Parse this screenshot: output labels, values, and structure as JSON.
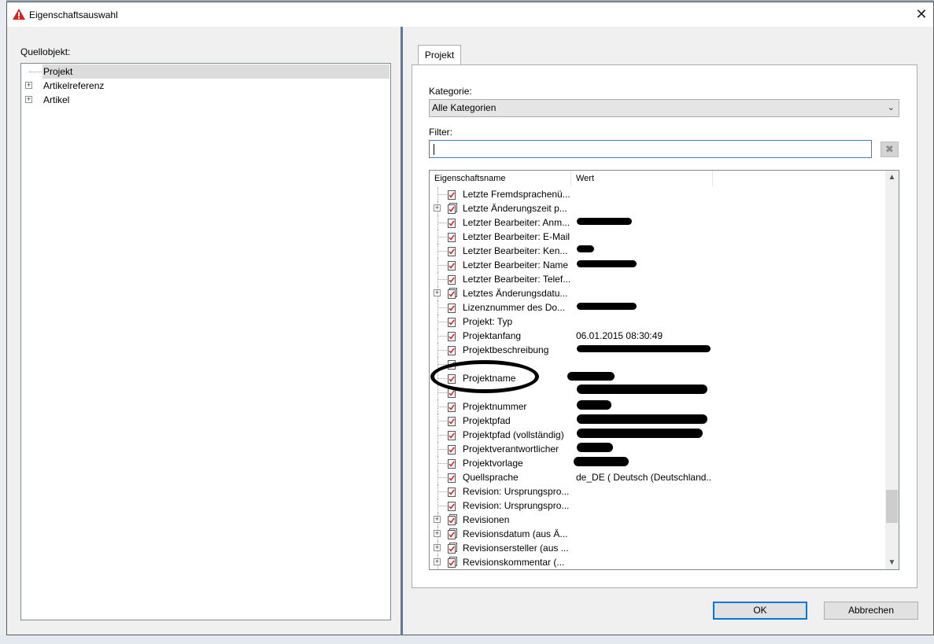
{
  "window": {
    "title": "Eigenschaftsauswahl",
    "close_glyph": "✕"
  },
  "left": {
    "label": "Quellobjekt:",
    "tree": [
      {
        "label": "Projekt",
        "expandable": false,
        "selected": true
      },
      {
        "label": "Artikelreferenz",
        "expandable": true,
        "selected": false
      },
      {
        "label": "Artikel",
        "expandable": true,
        "selected": false
      }
    ]
  },
  "right": {
    "tab_label": "Projekt",
    "category_label": "Kategorie:",
    "category_value": "Alle Kategorien",
    "filter_label": "Filter:",
    "filter_value": "",
    "clear_glyph": "✖",
    "columns": [
      "Eigenschaftsname",
      "Wert"
    ],
    "rows": [
      {
        "name": "Letzte Fremdsprachenü...",
        "value": "",
        "expandable": false,
        "icon": "single-property-icon"
      },
      {
        "name": "Letzte Änderungszeit p...",
        "value": "",
        "expandable": true,
        "icon": "multi-property-icon"
      },
      {
        "name": "Letzter Bearbeiter: Anm...",
        "value": "",
        "expandable": false,
        "icon": "single-property-icon"
      },
      {
        "name": "Letzter Bearbeiter: E-Mail",
        "value": "",
        "expandable": false,
        "icon": "single-property-icon"
      },
      {
        "name": "Letzter Bearbeiter: Ken...",
        "value": "",
        "expandable": false,
        "icon": "single-property-icon"
      },
      {
        "name": "Letzter Bearbeiter: Name",
        "value": "",
        "expandable": false,
        "icon": "single-property-icon"
      },
      {
        "name": "Letzter Bearbeiter: Telef...",
        "value": "",
        "expandable": false,
        "icon": "single-property-icon"
      },
      {
        "name": "Letztes Änderungsdatu...",
        "value": "",
        "expandable": true,
        "icon": "multi-property-icon"
      },
      {
        "name": "Lizenznummer des Do...",
        "value": "",
        "expandable": false,
        "icon": "single-property-icon"
      },
      {
        "name": "Projekt: Typ",
        "value": "",
        "expandable": false,
        "icon": "single-property-icon"
      },
      {
        "name": "Projektanfang",
        "value": "06.01.2015 08:30:49",
        "expandable": false,
        "icon": "single-property-icon"
      },
      {
        "name": "Projektbeschreibung",
        "value": "",
        "expandable": false,
        "icon": "single-property-icon"
      },
      {
        "name": "",
        "value": "",
        "expandable": false,
        "icon": "single-property-icon"
      },
      {
        "name": "Projektname",
        "value": "",
        "expandable": false,
        "icon": "single-property-icon"
      },
      {
        "name": "",
        "value": "",
        "expandable": false,
        "icon": "single-property-icon"
      },
      {
        "name": "Projektnummer",
        "value": "",
        "expandable": false,
        "icon": "single-property-icon"
      },
      {
        "name": "Projektpfad",
        "value": "",
        "expandable": false,
        "icon": "single-property-icon"
      },
      {
        "name": "Projektpfad (vollständig)",
        "value": "",
        "expandable": false,
        "icon": "single-property-icon"
      },
      {
        "name": "Projektverantwortlicher",
        "value": "",
        "expandable": false,
        "icon": "single-property-icon"
      },
      {
        "name": "Projektvorlage",
        "value": "",
        "expandable": false,
        "icon": "single-property-icon"
      },
      {
        "name": "Quellsprache",
        "value": "de_DE ( Deutsch (Deutschland...",
        "expandable": false,
        "icon": "single-property-icon"
      },
      {
        "name": "Revision: Ursprungspro...",
        "value": "",
        "expandable": false,
        "icon": "single-property-icon"
      },
      {
        "name": "Revision: Ursprungspro...",
        "value": "",
        "expandable": false,
        "icon": "single-property-icon"
      },
      {
        "name": "Revisionen",
        "value": "",
        "expandable": true,
        "icon": "multi-property-icon"
      },
      {
        "name": "Revisionsdatum (aus Ä...",
        "value": "",
        "expandable": true,
        "icon": "multi-property-icon"
      },
      {
        "name": "Revisionsersteller (aus ...",
        "value": "",
        "expandable": true,
        "icon": "multi-property-icon"
      },
      {
        "name": "Revisionskommentar (...",
        "value": "",
        "expandable": true,
        "icon": "multi-property-icon"
      }
    ]
  },
  "buttons": {
    "ok": "OK",
    "cancel": "Abbrechen"
  },
  "colors": {
    "accent": "#0078d7",
    "splitter": "#5b79a4",
    "warning_icon": "#d81e1e"
  }
}
